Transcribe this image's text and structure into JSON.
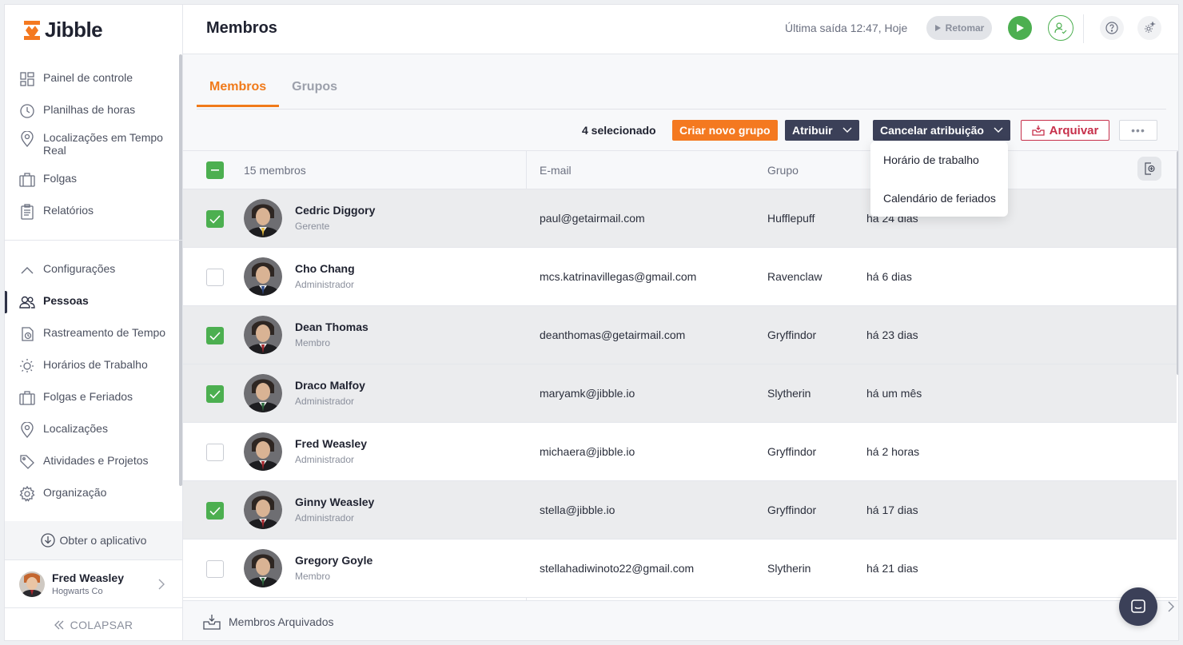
{
  "app": {
    "logo_text": "Jibble",
    "brand_color": "#f47920"
  },
  "sidebar": {
    "items": [
      {
        "label": "Painel de controle",
        "icon": "dashboard-icon"
      },
      {
        "label": "Planilhas de horas",
        "icon": "clock-icon"
      },
      {
        "label": "Localizações em Tempo Real",
        "icon": "location-pin-icon"
      },
      {
        "label": "Folgas",
        "icon": "suitcase-icon"
      },
      {
        "label": "Relatórios",
        "icon": "clipboard-icon"
      }
    ],
    "settings": {
      "label": "Configurações",
      "items": [
        {
          "label": "Pessoas",
          "icon": "people-icon",
          "active": true
        },
        {
          "label": "Rastreamento de Tempo",
          "icon": "time-tracking-icon"
        },
        {
          "label": "Horários de Trabalho",
          "icon": "work-schedule-icon"
        },
        {
          "label": "Folgas e Feriados",
          "icon": "suitcase-icon"
        },
        {
          "label": "Localizações",
          "icon": "location-pin-icon"
        },
        {
          "label": "Atividades e Projetos",
          "icon": "tag-icon"
        },
        {
          "label": "Organização",
          "icon": "gear-icon"
        }
      ]
    },
    "get_app": "Obter o aplicativo",
    "user": {
      "name": "Fred Weasley",
      "org": "Hogwarts Co"
    },
    "collapse": "COLAPSAR"
  },
  "header": {
    "title": "Membros",
    "last_out": "Última saída 12:47, Hoje",
    "resume_label": "Retomar"
  },
  "tabs": [
    {
      "label": "Membros",
      "active": true
    },
    {
      "label": "Grupos",
      "active": false
    }
  ],
  "toolbar": {
    "selected_count": "4 selecionado",
    "create_group": "Criar novo grupo",
    "assign": "Atribuir",
    "unassign": "Cancelar atribuição",
    "archive": "Arquivar",
    "more": "•••"
  },
  "dropdown": {
    "items": [
      "Horário de trabalho",
      "Calendário de feriados"
    ]
  },
  "table": {
    "members_count": "15 membros",
    "headers": {
      "email": "E-mail",
      "group": "Grupo"
    },
    "rows": [
      {
        "name": "Cedric Diggory",
        "role": "Gerente",
        "email": "paul@getairmail.com",
        "group": "Hufflepuff",
        "last": "há 24 dias",
        "selected": true,
        "tie": "#e3b93b"
      },
      {
        "name": "Cho Chang",
        "role": "Administrador",
        "email": "mcs.katrinavillegas@gmail.com",
        "group": "Ravenclaw",
        "last": "há 6 dias",
        "selected": false,
        "tie": "#2c4a8a"
      },
      {
        "name": "Dean Thomas",
        "role": "Membro",
        "email": "deanthomas@getairmail.com",
        "group": "Gryffindor",
        "last": "há 23 dias",
        "selected": true,
        "tie": "#a4262c"
      },
      {
        "name": "Draco Malfoy",
        "role": "Administrador",
        "email": "maryamk@jibble.io",
        "group": "Slytherin",
        "last": "há um mês",
        "selected": true,
        "tie": "#2d6a3e"
      },
      {
        "name": "Fred Weasley",
        "role": "Administrador",
        "email": "michaera@jibble.io",
        "group": "Gryffindor",
        "last": "há 2 horas",
        "selected": false,
        "tie": "#a4262c"
      },
      {
        "name": "Ginny Weasley",
        "role": "Administrador",
        "email": "stella@jibble.io",
        "group": "Gryffindor",
        "last": "há 17 dias",
        "selected": true,
        "tie": "#a4262c"
      },
      {
        "name": "Gregory Goyle",
        "role": "Membro",
        "email": "stellahadiwinoto22@gmail.com",
        "group": "Slytherin",
        "last": "há 21 dias",
        "selected": false,
        "tie": "#2d6a3e"
      }
    ]
  },
  "footer": {
    "archived_members": "Membros Arquivados"
  }
}
